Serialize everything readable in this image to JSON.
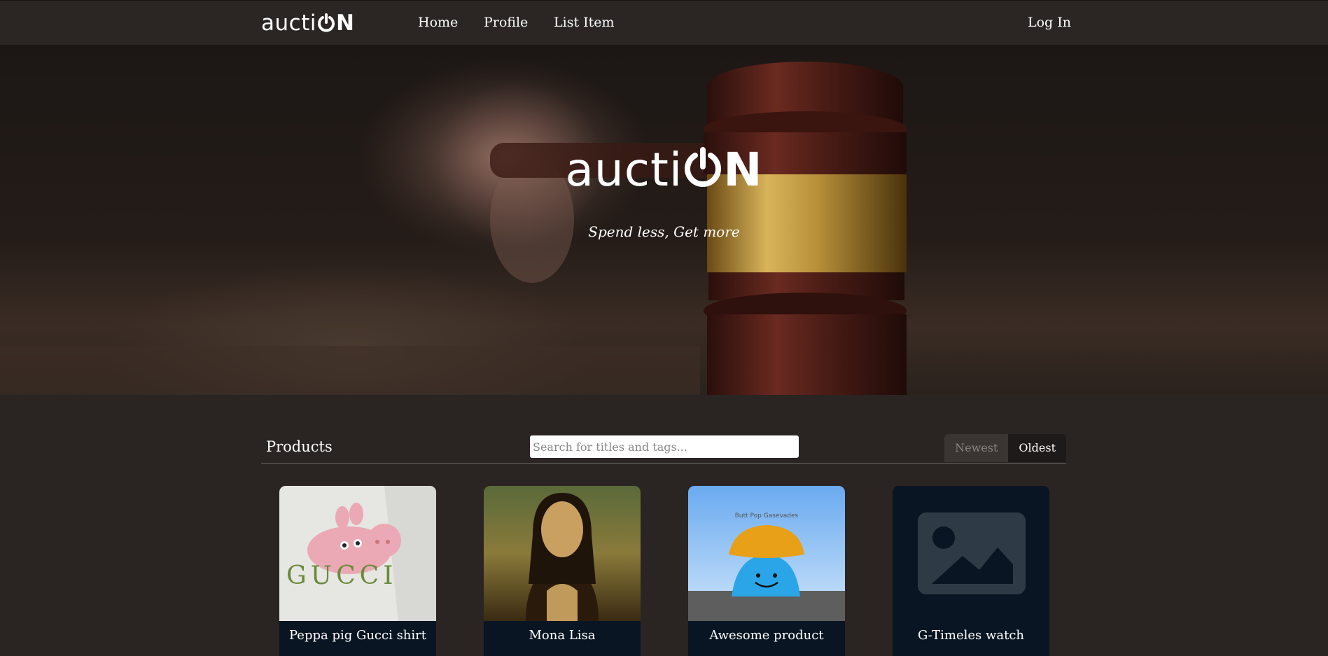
{
  "nav": {
    "brand_prefix": "aucti",
    "brand_suffix": "N",
    "links": [
      "Home",
      "Profile",
      "List Item"
    ],
    "login": "Log In"
  },
  "hero": {
    "logo_prefix": "aucti",
    "logo_suffix": "N",
    "tagline": "Spend less, Get more"
  },
  "products": {
    "title": "Products",
    "search_placeholder": "Search for titles and tags...",
    "sort": {
      "newest": "Newest",
      "oldest": "Oldest",
      "active": "Oldest"
    },
    "items": [
      {
        "title": "Peppa pig Gucci shirt",
        "image": "peppa-gucci-shirt",
        "image_text": "GUCCI"
      },
      {
        "title": "Mona Lisa",
        "image": "mona-lisa-painting"
      },
      {
        "title": "Awesome product",
        "image": "blue-blob-with-hat",
        "image_text": "Butt Pop Gasevades"
      },
      {
        "title": "G-Timeles watch",
        "image": "image-placeholder-icon"
      }
    ]
  },
  "colors": {
    "navbar": "#2b2624",
    "page_bg": "#2a2422",
    "card_footer": "#091522",
    "placeholder_icon": "#2e3b46"
  }
}
